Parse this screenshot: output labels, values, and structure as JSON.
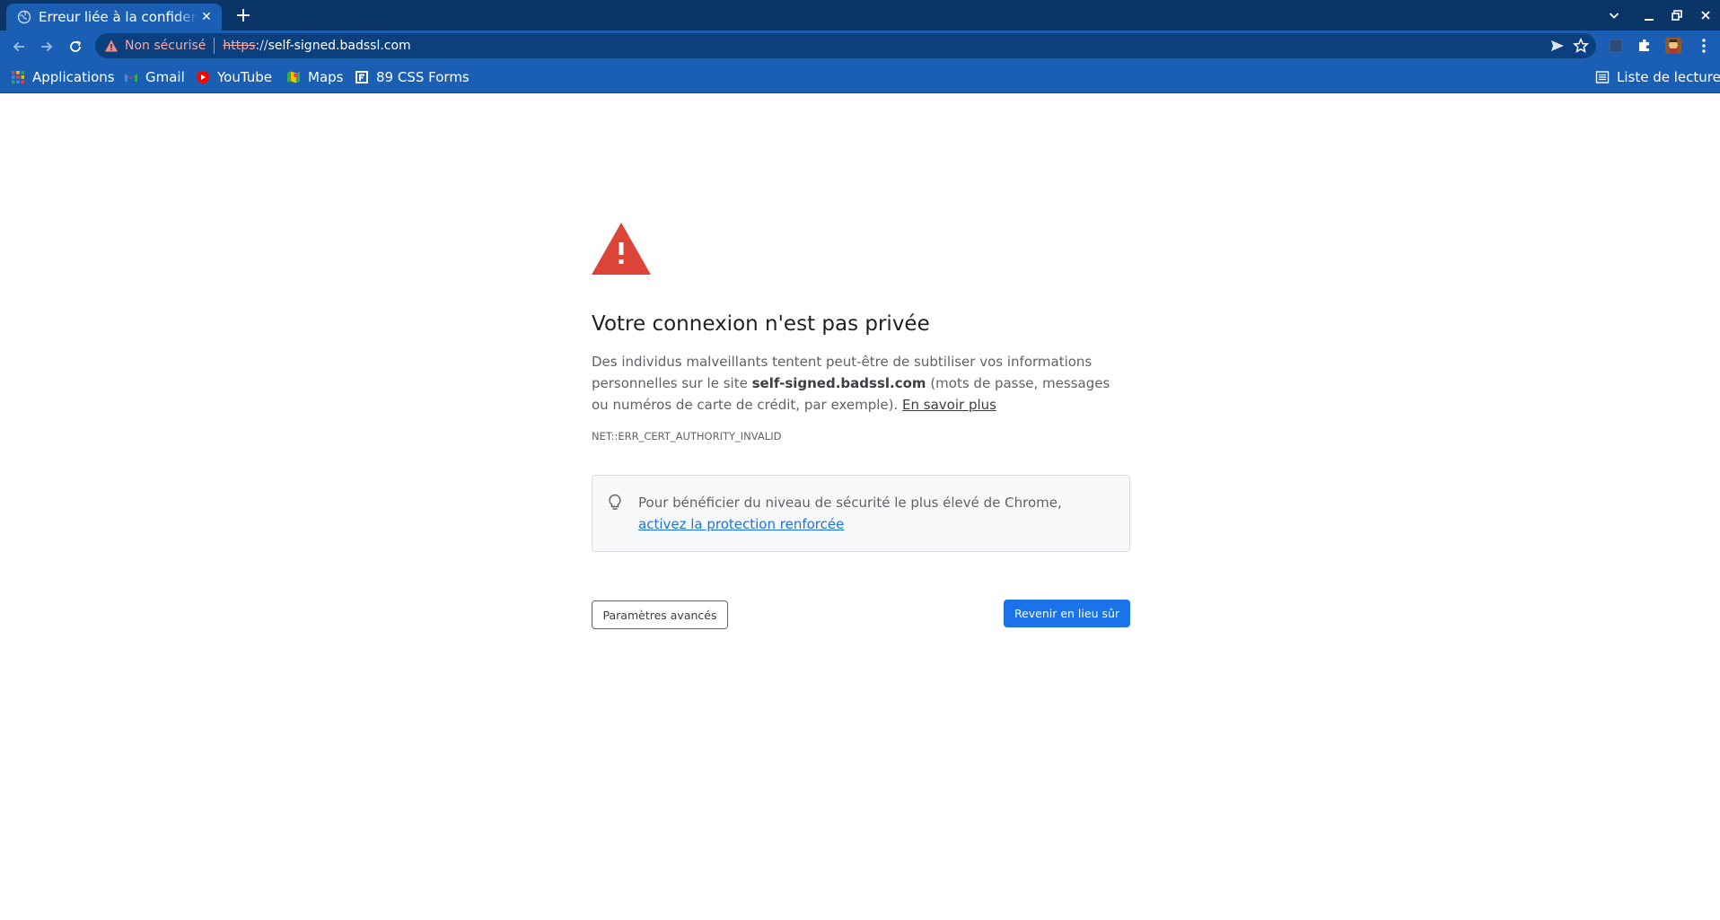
{
  "browser": {
    "tab": {
      "title": "Erreur liée à la confidentialité",
      "close_glyph": "✕",
      "favicon": "globe-icon"
    },
    "new_tab_glyph": "+",
    "window_controls": {
      "tab_search_glyph": "⌄",
      "minimize_glyph": "–",
      "restore_glyph": "❐",
      "close_glyph": "✕"
    },
    "omnibox": {
      "security_label": "Non sécurisé",
      "url_scheme": "https",
      "url_separator": "://",
      "url_host": "self-signed.badssl.com"
    },
    "bookmarks": [
      {
        "label": "Applications",
        "icon": "apps-grid-icon"
      },
      {
        "label": "Gmail",
        "icon": "gmail-icon"
      },
      {
        "label": "YouTube",
        "icon": "youtube-icon"
      },
      {
        "label": "Maps",
        "icon": "maps-icon"
      },
      {
        "label": "89 CSS Forms",
        "icon": "forms-icon"
      }
    ],
    "reading_list_label": "Liste de lecture"
  },
  "interstitial": {
    "headline": "Votre connexion n'est pas privée",
    "explanation_before": "Des individus malveillants tentent peut-être de subtiliser vos informations personnelles sur le site ",
    "explanation_host": "self-signed.badssl.com",
    "explanation_after": " (mots de passe, messages ou numéros de carte de crédit, par exemple). ",
    "learn_more": "En savoir plus",
    "error_code": "NET::ERR_CERT_AUTHORITY_INVALID",
    "enhanced_text": "Pour bénéficier du niveau de sécurité le plus élevé de Chrome, ",
    "enhanced_link": "activez la protection renforcée",
    "advanced_button": "Paramètres avancés",
    "back_button": "Revenir en lieu sûr"
  },
  "colors": {
    "tabstrip": "#0b3566",
    "toolbar": "#1a5fb4",
    "warning_red": "#db4437",
    "primary_blue": "#1a73e8"
  }
}
